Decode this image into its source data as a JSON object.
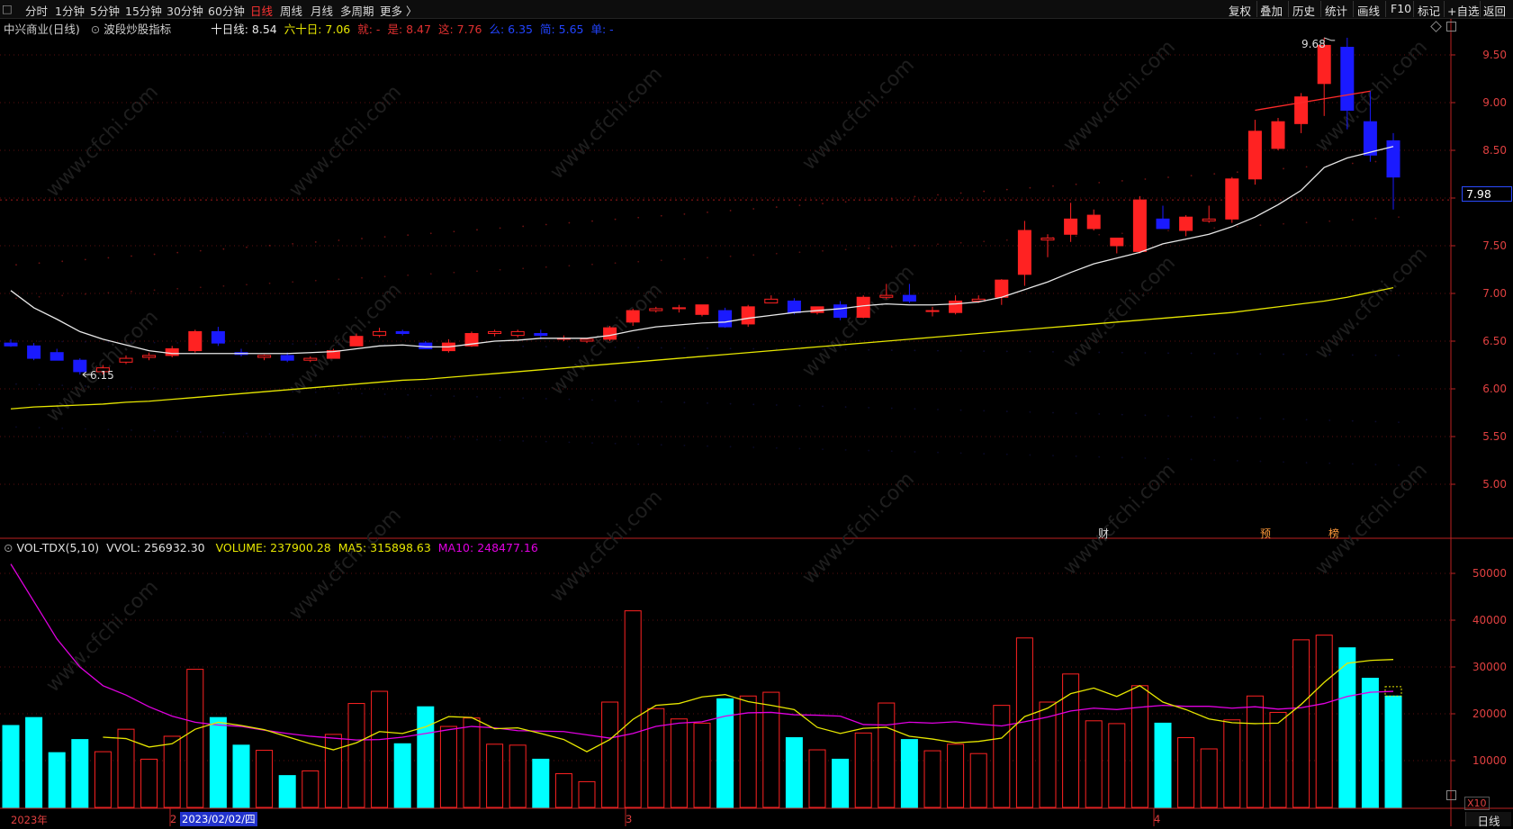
{
  "topbar": {
    "logo": "□",
    "tabs": [
      "分时",
      "1分钟",
      "5分钟",
      "15分钟",
      "30分钟",
      "60分钟",
      "日线",
      "周线",
      "月线",
      "多周期",
      "更多 〉"
    ],
    "active_tab": "日线",
    "right_buttons": [
      "复权",
      "叠加",
      "历史",
      "统计",
      "画线",
      "F10",
      "标记",
      "+自选",
      "返回"
    ]
  },
  "main": {
    "stock_name": "中兴商业(日线)",
    "indicator": "波段炒股指标",
    "ma_line": {
      "ma10_label": "十日线: 8.54",
      "ma60_label": "六十日: 7.06",
      "items": [
        "就: -",
        "是: 8.47",
        "这: 7.76",
        "么: 6.35",
        "简: 5.65",
        "单: -"
      ]
    },
    "current_price": "7.98",
    "high_label": "9.68",
    "low_label": "6.15",
    "y_ticks": [
      "9.50",
      "9.00",
      "8.50",
      "8.00",
      "7.50",
      "7.00",
      "6.50",
      "6.00",
      "5.50",
      "5.00"
    ],
    "markers": [
      "财",
      "预",
      "榜"
    ]
  },
  "volume": {
    "title": "VOL-TDX(5,10)",
    "vvol": "VVOL: 256932.30",
    "volume": "VOLUME: 237900.28",
    "ma5": "MA5: 315898.63",
    "ma10": "MA10: 248477.16",
    "y_ticks": [
      "50000",
      "40000",
      "30000",
      "20000",
      "10000"
    ],
    "unit": "X10"
  },
  "dates": {
    "year": "2023年",
    "m2": "2",
    "selected": "2023/02/02/四",
    "m3": "3",
    "m4": "4"
  },
  "bottom_tag": "日线",
  "watermark": "www.cfchi.com",
  "colors": {
    "up": "#ff2222",
    "down": "#1a1aff",
    "vol_down": "#00ffff",
    "ma10": "#e8e8e8",
    "ma60": "#e6e600",
    "vma5": "#e6e600",
    "vma10": "#e000e0",
    "axis": "#e04040"
  },
  "chart_data": {
    "type": "candlestick",
    "ohlc": [
      [
        6.48,
        6.52,
        6.44,
        6.45
      ],
      [
        6.45,
        6.48,
        6.3,
        6.32
      ],
      [
        6.38,
        6.42,
        6.3,
        6.3
      ],
      [
        6.3,
        6.32,
        6.15,
        6.18
      ],
      [
        6.18,
        6.25,
        6.15,
        6.22
      ],
      [
        6.28,
        6.35,
        6.26,
        6.32
      ],
      [
        6.33,
        6.38,
        6.3,
        6.35
      ],
      [
        6.35,
        6.45,
        6.33,
        6.42
      ],
      [
        6.4,
        6.62,
        6.38,
        6.6
      ],
      [
        6.6,
        6.65,
        6.45,
        6.48
      ],
      [
        6.38,
        6.42,
        6.34,
        6.36
      ],
      [
        6.33,
        6.36,
        6.3,
        6.35
      ],
      [
        6.35,
        6.38,
        6.28,
        6.3
      ],
      [
        6.3,
        6.34,
        6.28,
        6.32
      ],
      [
        6.32,
        6.42,
        6.32,
        6.4
      ],
      [
        6.45,
        6.58,
        6.45,
        6.55
      ],
      [
        6.56,
        6.64,
        6.54,
        6.6
      ],
      [
        6.6,
        6.62,
        6.56,
        6.58
      ],
      [
        6.48,
        6.5,
        6.42,
        6.42
      ],
      [
        6.4,
        6.52,
        6.38,
        6.48
      ],
      [
        6.45,
        6.6,
        6.44,
        6.58
      ],
      [
        6.58,
        6.62,
        6.55,
        6.6
      ],
      [
        6.56,
        6.62,
        6.54,
        6.6
      ],
      [
        6.58,
        6.62,
        6.52,
        6.56
      ],
      [
        6.52,
        6.56,
        6.5,
        6.53
      ],
      [
        6.5,
        6.53,
        6.48,
        6.52
      ],
      [
        6.52,
        6.66,
        6.5,
        6.64
      ],
      [
        6.7,
        6.84,
        6.66,
        6.82
      ],
      [
        6.82,
        6.86,
        6.8,
        6.84
      ],
      [
        6.84,
        6.88,
        6.8,
        6.85
      ],
      [
        6.78,
        6.88,
        6.76,
        6.88
      ],
      [
        6.82,
        6.85,
        6.64,
        6.65
      ],
      [
        6.68,
        6.88,
        6.65,
        6.86
      ],
      [
        6.9,
        6.98,
        6.9,
        6.94
      ],
      [
        6.92,
        6.95,
        6.78,
        6.8
      ],
      [
        6.8,
        6.86,
        6.78,
        6.86
      ],
      [
        6.88,
        6.92,
        6.72,
        6.75
      ],
      [
        6.75,
        6.98,
        6.74,
        6.96
      ],
      [
        6.96,
        7.1,
        6.94,
        6.98
      ],
      [
        6.98,
        7.1,
        6.9,
        6.92
      ],
      [
        6.82,
        6.86,
        6.76,
        6.82
      ],
      [
        6.8,
        6.98,
        6.78,
        6.92
      ],
      [
        6.92,
        6.98,
        6.9,
        6.94
      ],
      [
        6.96,
        7.15,
        6.88,
        7.14
      ],
      [
        7.2,
        7.76,
        7.08,
        7.66
      ],
      [
        7.56,
        7.62,
        7.38,
        7.58
      ],
      [
        7.62,
        7.95,
        7.54,
        7.78
      ],
      [
        7.68,
        7.88,
        7.66,
        7.82
      ],
      [
        7.5,
        7.58,
        7.42,
        7.58
      ],
      [
        7.44,
        8.02,
        7.42,
        7.98
      ],
      [
        7.78,
        7.92,
        7.7,
        7.68
      ],
      [
        7.66,
        7.82,
        7.6,
        7.8
      ],
      [
        7.76,
        7.92,
        7.74,
        7.78
      ],
      [
        7.78,
        8.22,
        7.74,
        8.2
      ],
      [
        8.2,
        8.82,
        8.14,
        8.7
      ],
      [
        8.52,
        8.84,
        8.5,
        8.8
      ],
      [
        8.78,
        9.1,
        8.68,
        9.06
      ],
      [
        9.2,
        9.68,
        8.86,
        9.6
      ],
      [
        9.58,
        9.68,
        8.72,
        8.92
      ],
      [
        8.8,
        9.12,
        8.38,
        8.45
      ],
      [
        8.6,
        8.68,
        7.88,
        8.22
      ]
    ],
    "ma10": [
      7.03,
      6.85,
      6.73,
      6.6,
      6.52,
      6.46,
      6.4,
      6.37,
      6.37,
      6.37,
      6.37,
      6.37,
      6.37,
      6.38,
      6.39,
      6.42,
      6.45,
      6.46,
      6.44,
      6.44,
      6.47,
      6.5,
      6.51,
      6.53,
      6.53,
      6.53,
      6.56,
      6.61,
      6.65,
      6.67,
      6.69,
      6.7,
      6.74,
      6.77,
      6.8,
      6.82,
      6.84,
      6.87,
      6.89,
      6.88,
      6.88,
      6.89,
      6.91,
      6.96,
      7.04,
      7.12,
      7.22,
      7.31,
      7.37,
      7.43,
      7.52,
      7.57,
      7.62,
      7.7,
      7.8,
      7.93,
      8.08,
      8.32,
      8.42,
      8.48,
      8.54
    ],
    "ma60": [
      5.79,
      5.81,
      5.82,
      5.83,
      5.84,
      5.86,
      5.87,
      5.89,
      5.91,
      5.93,
      5.95,
      5.97,
      5.99,
      6.01,
      6.03,
      6.05,
      6.07,
      6.09,
      6.1,
      6.12,
      6.14,
      6.16,
      6.18,
      6.2,
      6.22,
      6.24,
      6.26,
      6.28,
      6.3,
      6.32,
      6.34,
      6.36,
      6.38,
      6.4,
      6.42,
      6.44,
      6.46,
      6.48,
      6.5,
      6.52,
      6.54,
      6.56,
      6.58,
      6.6,
      6.62,
      6.64,
      6.66,
      6.68,
      6.7,
      6.72,
      6.74,
      6.76,
      6.78,
      6.8,
      6.83,
      6.86,
      6.89,
      6.92,
      6.96,
      7.01,
      7.06
    ],
    "volume": [
      17500,
      19200,
      11700,
      14500,
      11900,
      16700,
      10300,
      15200,
      29500,
      19200,
      13300,
      12200,
      6800,
      7800,
      15600,
      22200,
      24800,
      13600,
      21500,
      17300,
      19100,
      13500,
      13300,
      10300,
      7200,
      5500,
      22500,
      42000,
      21100,
      18900,
      18000,
      23200,
      23800,
      24600,
      14900,
      12300,
      10300,
      15900,
      22300,
      14500,
      12100,
      13500,
      11500,
      21800,
      36200,
      22500,
      28500,
      18500,
      17900,
      26000,
      18000,
      14900,
      12500,
      18700,
      23800,
      20300,
      35800,
      36800,
      34100,
      27600,
      23790
    ],
    "vol_ma5": [
      null,
      null,
      null,
      null,
      15000,
      14700,
      12900,
      13600,
      16700,
      18200,
      17500,
      16600,
      15100,
      13600,
      12300,
      13800,
      16200,
      15800,
      17200,
      19400,
      19200,
      16800,
      17000,
      15800,
      14500,
      11900,
      14500,
      18800,
      21800,
      22200,
      23600,
      24100,
      22600,
      21800,
      20900,
      17100,
      15800,
      16900,
      17100,
      15200,
      14600,
      13800,
      14100,
      14800,
      19400,
      21200,
      24300,
      25500,
      23700,
      26000,
      22500,
      20900,
      18900,
      18100,
      17900,
      18000,
      22000,
      26700,
      30800,
      31400,
      31600
    ],
    "vol_ma10": [
      52000,
      44000,
      36000,
      30000,
      26000,
      24000,
      21500,
      19500,
      18200,
      17600,
      17300,
      16500,
      15800,
      15200,
      14800,
      14400,
      14500,
      15000,
      15800,
      16600,
      17300,
      17000,
      16400,
      16300,
      16200,
      15500,
      14800,
      15800,
      17300,
      18000,
      18300,
      19500,
      20200,
      20300,
      19800,
      19700,
      19500,
      17700,
      17600,
      18200,
      18000,
      18300,
      17800,
      17400,
      18300,
      19300,
      20600,
      21200,
      20900,
      21400,
      21800,
      21600,
      21600,
      21200,
      21500,
      21000,
      21300,
      22200,
      23700,
      24600,
      24800
    ]
  }
}
